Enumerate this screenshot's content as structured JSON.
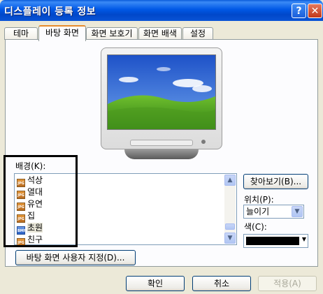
{
  "window": {
    "title": "디스플레이 등록 정보",
    "help_glyph": "?",
    "close_glyph": "✕"
  },
  "tabs": [
    {
      "label": "테마"
    },
    {
      "label": "바탕 화면"
    },
    {
      "label": "화면 보호기"
    },
    {
      "label": "화면 배색"
    },
    {
      "label": "설정"
    }
  ],
  "background": {
    "label": "배경(K):",
    "items": [
      {
        "name": "석상",
        "type": "jpg"
      },
      {
        "name": "열대",
        "type": "jpg"
      },
      {
        "name": "유연",
        "type": "jpg"
      },
      {
        "name": "집",
        "type": "jpg"
      },
      {
        "name": "초원",
        "type": "bmp",
        "selected": true
      },
      {
        "name": "친구",
        "type": "jpg"
      }
    ]
  },
  "browse_button": "찾아보기(B)...",
  "position": {
    "label": "위치(P):",
    "value": "늘이기"
  },
  "color": {
    "label": "색(C):",
    "value": "#000000"
  },
  "customize_button": "바탕 화면 사용자 지정(D)...",
  "footer": {
    "ok": "확인",
    "cancel": "취소",
    "apply": "적용(A)"
  },
  "colors": {
    "title_bar": "#0058e6",
    "dialog_bg": "#ece9d8",
    "active_tab_accent": "#e68b2c"
  }
}
